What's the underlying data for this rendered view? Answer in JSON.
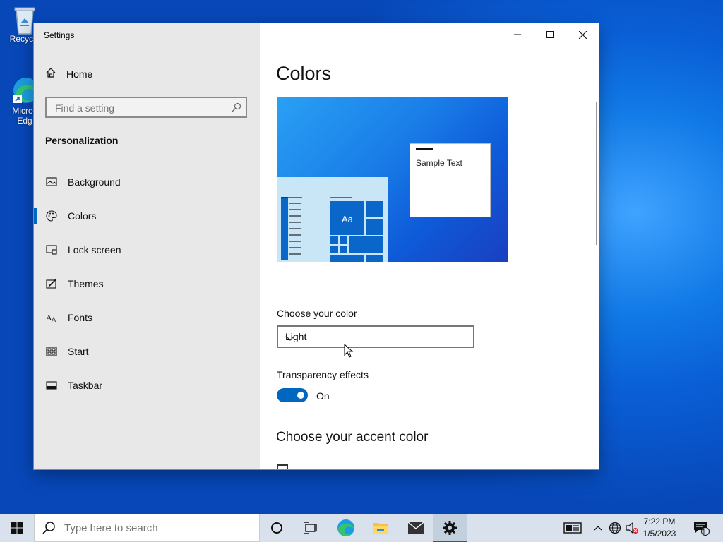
{
  "desktop": {
    "icons": [
      {
        "label": "Recycle",
        "icon": "recycle-bin-icon"
      },
      {
        "label": "Micros\nEdg",
        "icon": "edge-icon"
      }
    ]
  },
  "window": {
    "title": "Settings",
    "controls": [
      "minimize",
      "maximize",
      "close"
    ]
  },
  "sidebar": {
    "home_label": "Home",
    "search_placeholder": "Find a setting",
    "section_title": "Personalization",
    "items": [
      {
        "label": "Background",
        "icon": "picture-icon"
      },
      {
        "label": "Colors",
        "icon": "palette-icon",
        "active": true
      },
      {
        "label": "Lock screen",
        "icon": "lock-screen-icon"
      },
      {
        "label": "Themes",
        "icon": "brush-icon"
      },
      {
        "label": "Fonts",
        "icon": "font-icon"
      },
      {
        "label": "Start",
        "icon": "start-tiles-icon"
      },
      {
        "label": "Taskbar",
        "icon": "taskbar-icon"
      }
    ]
  },
  "content": {
    "page_title": "Colors",
    "preview": {
      "sample_text": "Sample Text",
      "tile_text": "Aa"
    },
    "choose_color_label": "Choose your color",
    "choose_color_value": "Light",
    "transparency_label": "Transparency effects",
    "transparency_state": "On",
    "accent_heading": "Choose your accent color"
  },
  "taskbar": {
    "search_placeholder": "Type here to search",
    "time": "7:22 PM",
    "date": "1/5/2023",
    "notification_count": "1"
  },
  "colors": {
    "accent": "#0067c0",
    "sidebar_bg": "#e8e8e8",
    "desktop": "#0a5fd6"
  }
}
